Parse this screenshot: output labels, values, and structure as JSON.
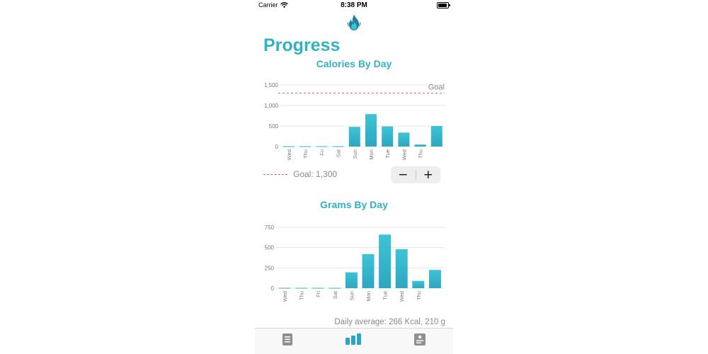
{
  "status_bar": {
    "carrier": "Carrier",
    "time": "8:38 PM",
    "icons": [
      "wifi-icon",
      "battery-icon"
    ]
  },
  "app_logo": "flame-icon",
  "page_title": "Progress",
  "calories_chart": {
    "chart_data": {
      "type": "bar",
      "title": "Calories By Day",
      "categories": [
        "Wed",
        "Thu",
        "Fri",
        "Sat",
        "Sun",
        "Mon",
        "Tue",
        "Wed",
        "Thu",
        ""
      ],
      "values": [
        8,
        8,
        8,
        8,
        480,
        790,
        490,
        340,
        50,
        500
      ],
      "yticks": [
        0,
        500,
        1000,
        1500
      ],
      "ytick_labels": [
        "0",
        "500",
        "1,000",
        "1,500"
      ],
      "ylim": [
        0,
        1500
      ],
      "goal": 1300,
      "goal_label": "Goal",
      "grid": true
    },
    "goal_legend": "Goal: 1,300",
    "stepper": {
      "minus": "−",
      "plus": "+"
    }
  },
  "grams_chart": {
    "chart_data": {
      "type": "bar",
      "title": "Grams By Day",
      "categories": [
        "Wed",
        "Thu",
        "Fri",
        "Sat",
        "Sun",
        "Mon",
        "Tue",
        "Wed",
        "Thu",
        ""
      ],
      "values": [
        4,
        4,
        4,
        4,
        195,
        420,
        660,
        480,
        90,
        225
      ],
      "yticks": [
        0,
        250,
        500,
        750
      ],
      "ytick_labels": [
        "0",
        "250",
        "500",
        "750"
      ],
      "ylim": [
        0,
        750
      ],
      "grid": true
    }
  },
  "daily_average": "Daily average: 266 Kcal, 210 g",
  "colors": {
    "accent": "#33b1c4",
    "bar_top": "#3ec3d6",
    "bar_bottom": "#2ca7c0",
    "goal_line": "#e05a55"
  },
  "tabs": [
    {
      "icon": "list-icon",
      "active": false
    },
    {
      "icon": "bar-chart-icon",
      "active": true
    },
    {
      "icon": "journal-icon",
      "active": false
    }
  ]
}
